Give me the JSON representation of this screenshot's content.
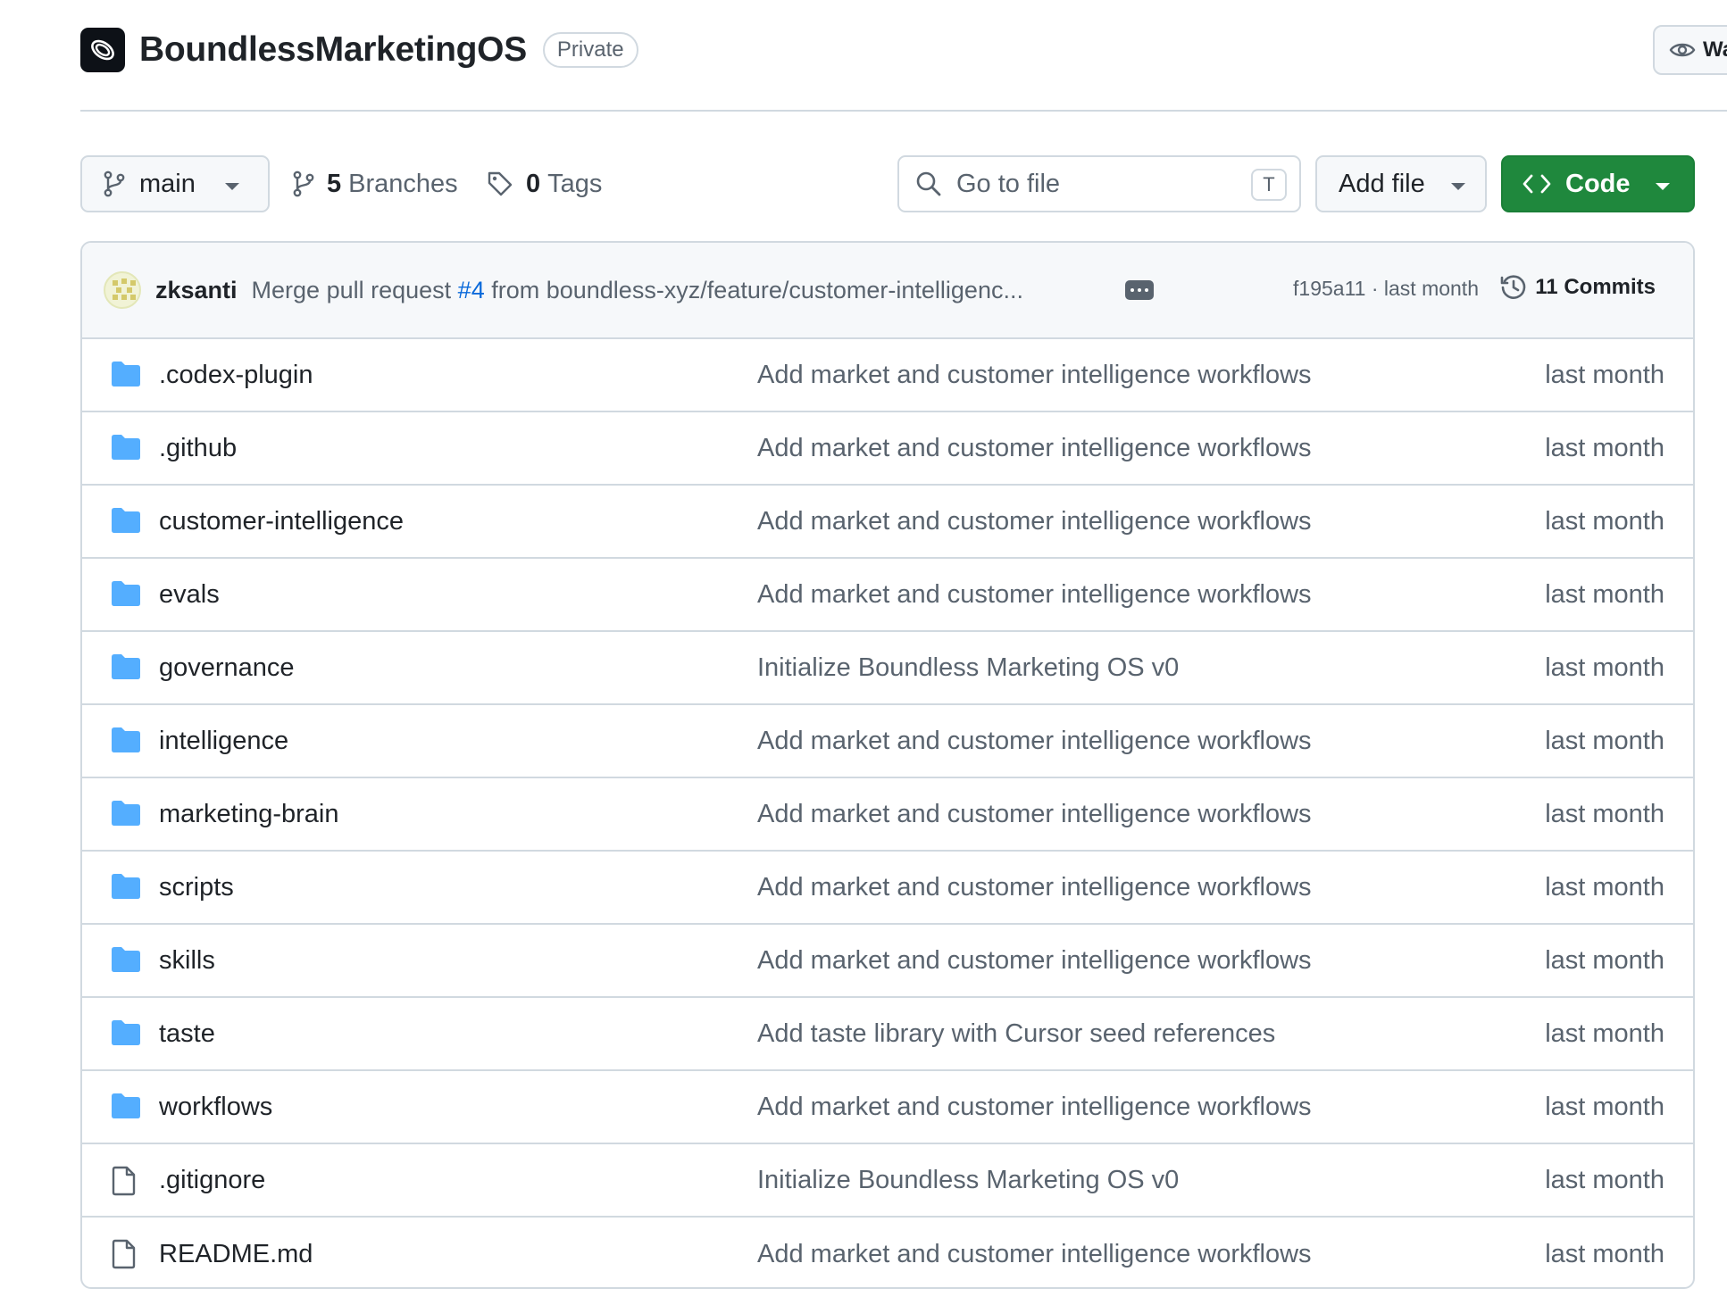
{
  "repo": {
    "name": "BoundlessMarketingOS",
    "visibility": "Private",
    "watch_label": "Watch"
  },
  "toolbar": {
    "branch": "main",
    "branches_count": "5",
    "branches_label": "Branches",
    "tags_count": "0",
    "tags_label": "Tags",
    "search_placeholder": "Go to file",
    "search_shortcut": "T",
    "add_file_label": "Add file",
    "code_label": "Code"
  },
  "latest_commit": {
    "author": "zksanti",
    "message_prefix": "Merge pull request ",
    "pr_ref": "#4",
    "message_suffix": " from boundless-xyz/feature/customer-intelligenc...",
    "sha_time": "f195a11 · last month",
    "commits_label": "11 Commits"
  },
  "colors": {
    "folder": "#54aeff",
    "code_button": "#1f883d",
    "link": "#0969da"
  },
  "files": [
    {
      "name": ".codex-plugin",
      "type": "folder",
      "commit": "Add market and customer intelligence workflows",
      "date": "last month"
    },
    {
      "name": ".github",
      "type": "folder",
      "commit": "Add market and customer intelligence workflows",
      "date": "last month"
    },
    {
      "name": "customer-intelligence",
      "type": "folder",
      "commit": "Add market and customer intelligence workflows",
      "date": "last month"
    },
    {
      "name": "evals",
      "type": "folder",
      "commit": "Add market and customer intelligence workflows",
      "date": "last month"
    },
    {
      "name": "governance",
      "type": "folder",
      "commit": "Initialize Boundless Marketing OS v0",
      "date": "last month"
    },
    {
      "name": "intelligence",
      "type": "folder",
      "commit": "Add market and customer intelligence workflows",
      "date": "last month"
    },
    {
      "name": "marketing-brain",
      "type": "folder",
      "commit": "Add market and customer intelligence workflows",
      "date": "last month"
    },
    {
      "name": "scripts",
      "type": "folder",
      "commit": "Add market and customer intelligence workflows",
      "date": "last month"
    },
    {
      "name": "skills",
      "type": "folder",
      "commit": "Add market and customer intelligence workflows",
      "date": "last month"
    },
    {
      "name": "taste",
      "type": "folder",
      "commit": "Add taste library with Cursor seed references",
      "date": "last month"
    },
    {
      "name": "workflows",
      "type": "folder",
      "commit": "Add market and customer intelligence workflows",
      "date": "last month"
    },
    {
      "name": ".gitignore",
      "type": "file",
      "commit": "Initialize Boundless Marketing OS v0",
      "date": "last month"
    },
    {
      "name": "README.md",
      "type": "file",
      "commit": "Add market and customer intelligence workflows",
      "date": "last month"
    }
  ]
}
